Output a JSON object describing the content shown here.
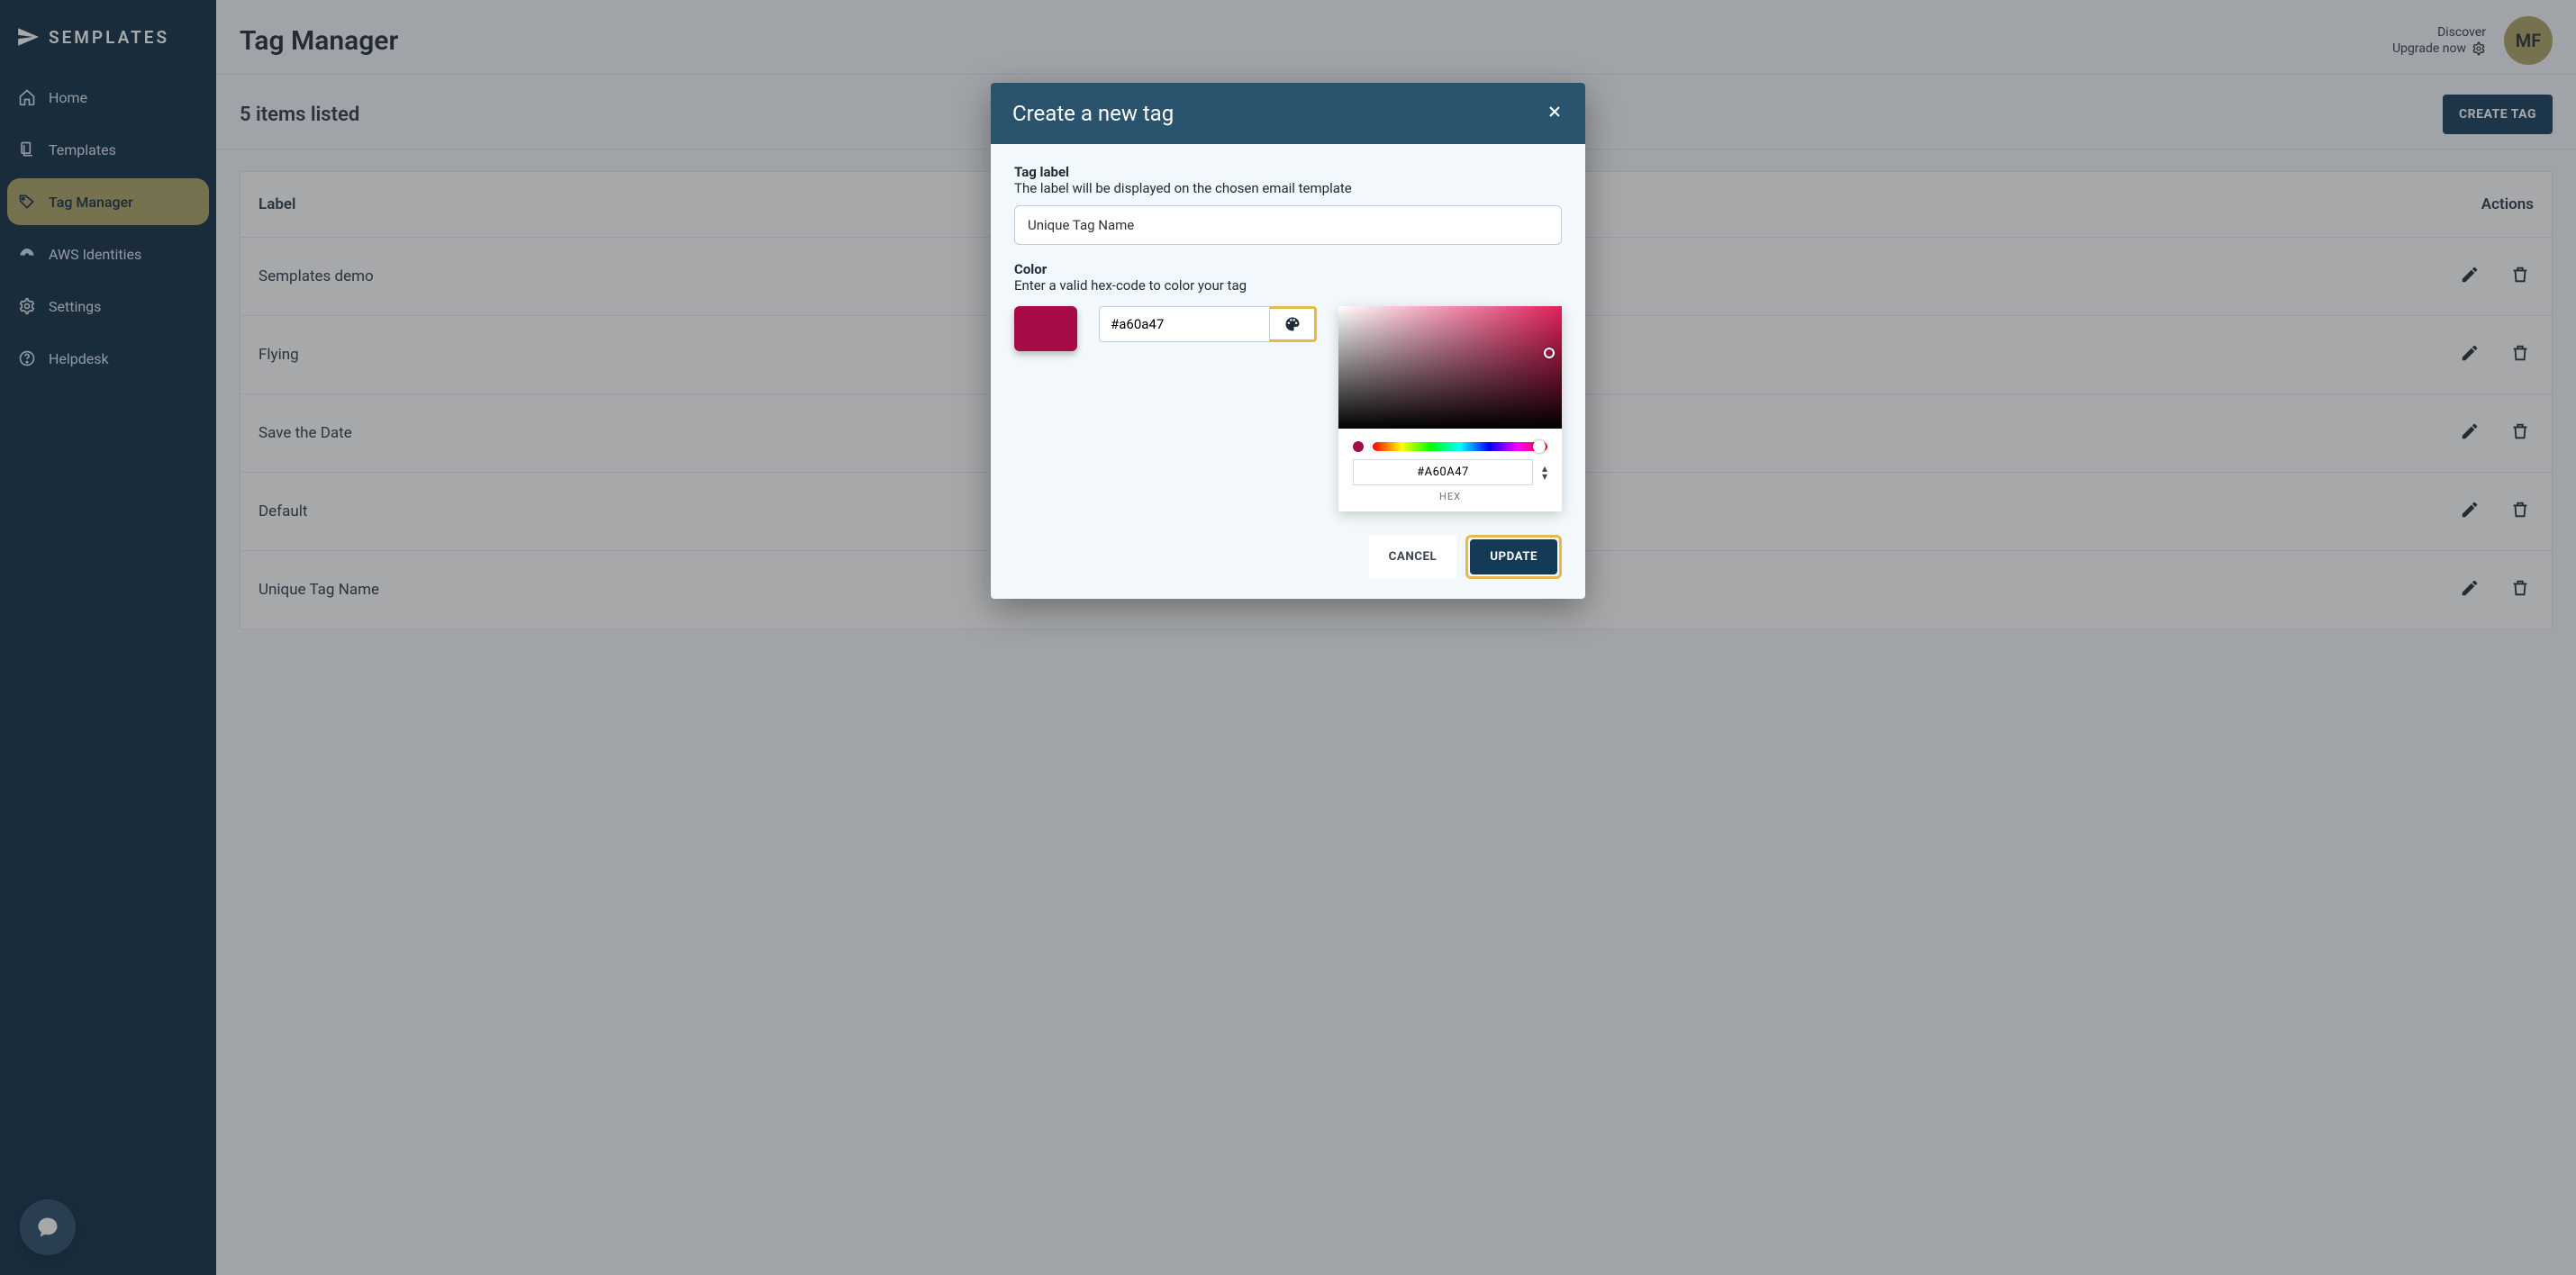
{
  "brand": "SEMPLATES",
  "sidebar": {
    "items": [
      {
        "label": "Home",
        "icon": "home"
      },
      {
        "label": "Templates",
        "icon": "templates"
      },
      {
        "label": "Tag Manager",
        "icon": "tag",
        "active": true
      },
      {
        "label": "AWS Identities",
        "icon": "fingerprint"
      },
      {
        "label": "Settings",
        "icon": "gear"
      },
      {
        "label": "Helpdesk",
        "icon": "help"
      }
    ]
  },
  "header": {
    "title": "Tag Manager",
    "discover": "Discover",
    "upgrade": "Upgrade now",
    "avatar": "MF"
  },
  "list": {
    "count_label": "5 items listed",
    "create_btn": "CREATE TAG",
    "col_label": "Label",
    "col_actions": "Actions",
    "rows": [
      {
        "label": "Semplates demo"
      },
      {
        "label": "Flying"
      },
      {
        "label": "Save the Date"
      },
      {
        "label": "Default"
      },
      {
        "label": "Unique Tag Name"
      }
    ]
  },
  "dialog": {
    "title": "Create a new tag",
    "tag_label_title": "Tag label",
    "tag_label_desc": "The label will be displayed on the chosen email template",
    "tag_label_value": "Unique Tag Name",
    "color_title": "Color",
    "color_desc": "Enter a valid hex-code to color your tag",
    "hex_value": "#a60a47",
    "swatch_color": "#a60a47",
    "picker_hex": "#A60A47",
    "picker_hex_label": "HEX",
    "cancel": "CANCEL",
    "update": "UPDATE"
  }
}
